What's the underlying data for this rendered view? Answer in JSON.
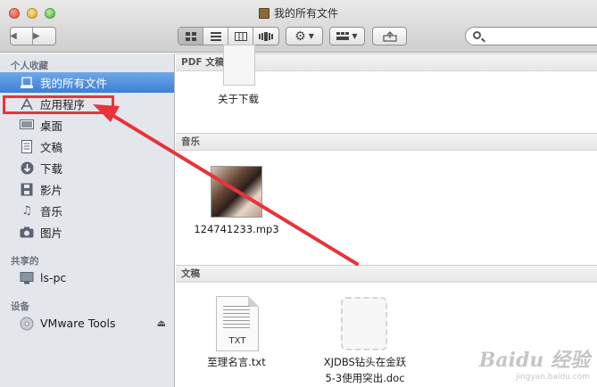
{
  "window": {
    "title": "我的所有文件"
  },
  "toolbar": {
    "back_icon": "chevron-left",
    "forward_icon": "chevron-right",
    "view_modes": [
      "icon-view",
      "list-view",
      "column-view",
      "coverflow-view"
    ],
    "selected_view": "icon-view",
    "search": {
      "value": "",
      "placeholder": ""
    }
  },
  "sidebar": {
    "favorites_heading": "个人收藏",
    "favorites": [
      {
        "label": "我的所有文件",
        "icon": "all-files-icon",
        "selected": true
      },
      {
        "label": "应用程序",
        "icon": "applications-icon",
        "selected": false
      },
      {
        "label": "桌面",
        "icon": "desktop-icon",
        "selected": false
      },
      {
        "label": "文稿",
        "icon": "documents-icon",
        "selected": false
      },
      {
        "label": "下载",
        "icon": "downloads-icon",
        "selected": false
      },
      {
        "label": "影片",
        "icon": "movies-icon",
        "selected": false
      },
      {
        "label": "音乐",
        "icon": "music-icon",
        "selected": false
      },
      {
        "label": "图片",
        "icon": "pictures-icon",
        "selected": false
      }
    ],
    "shared_heading": "共享的",
    "shared": [
      {
        "label": "ls-pc",
        "icon": "computer-icon"
      }
    ],
    "devices_heading": "设备",
    "devices": [
      {
        "label": "VMware Tools",
        "icon": "disc-icon",
        "eject": true
      }
    ]
  },
  "main": {
    "sections": [
      {
        "title": "PDF 文稿",
        "files": [
          {
            "name": "关于下载"
          }
        ]
      },
      {
        "title": "音乐",
        "files": [
          {
            "name": "124741233.mp3"
          }
        ]
      },
      {
        "title": "文稿",
        "files": [
          {
            "name": "至理名言.txt",
            "badge": "TXT"
          },
          {
            "name_line1": "XJDBS钻头在金跃",
            "name_line2": "5-3使用突出.doc"
          }
        ]
      }
    ]
  },
  "annotation": {
    "color": "#e8333a"
  },
  "watermark": {
    "logo": "Baidu 经验",
    "url": "jingyan.baidu.com"
  }
}
